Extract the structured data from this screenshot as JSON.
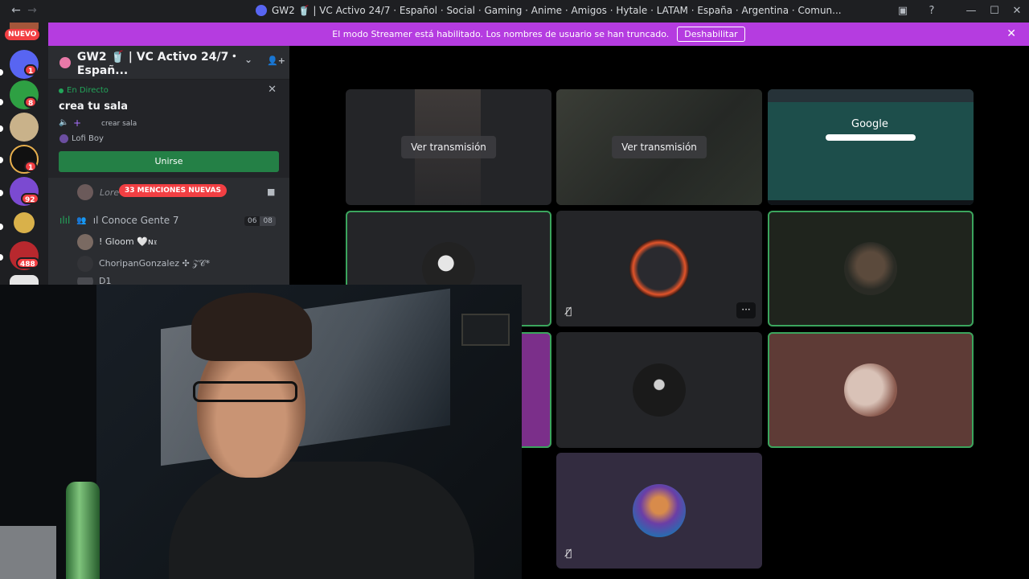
{
  "titlebar": {
    "back": "←",
    "forward": "→",
    "title": "GW2 🥤 | VC Activo 24/7 · Español · Social · Gaming · Anime · Amigos · Hytale · LATAM · España · Argentina · Comun...",
    "help": "?",
    "minimize": "—",
    "maximize": "☐",
    "close": "✕"
  },
  "banner": {
    "message": "El modo Streamer está habilitado. Los nombres de usuario se han truncado.",
    "button": "Deshabilitar",
    "close": "✕"
  },
  "rail": {
    "new_label": "NUEVO",
    "badges": [
      "1",
      "8",
      "1",
      "92",
      "488"
    ]
  },
  "server": {
    "name": "GW2 🥤 | VC Activo 24/7・Españ...",
    "chevron": "⌄",
    "invite_icon": "👤+"
  },
  "live": {
    "label": "En Directo",
    "room": "crea tu sala",
    "sub": "crear sala",
    "user": "Lofi Boy",
    "join": "Unirse",
    "close": "✕"
  },
  "channels": {
    "partial_user": "Lore",
    "mentions": "33 MENCIONES NUEVAS",
    "voice_channel": "ıl Conoce Gente 7",
    "count_a": "06",
    "count_b": "08",
    "members": [
      "! Gloom 🤍ɴ𝔵",
      "ChoripanGonzalez ✣ 𝒵𝒞*",
      "D1"
    ]
  },
  "tiles": {
    "watch_label": "Ver transmisión",
    "watch_label_2": "Ver transmisión",
    "google_logo": "Google",
    "more": "···",
    "mute": "🎙̸"
  },
  "colors": {
    "banner": "#b53ce0",
    "join_green": "#248046",
    "speaking_ring": "#3ba55d",
    "mention_red": "#f23f43"
  }
}
